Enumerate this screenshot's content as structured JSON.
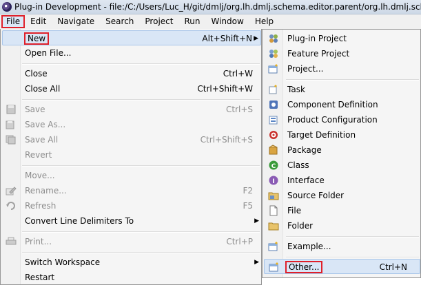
{
  "window": {
    "title": "Plug-in Development - file:/C:/Users/Luc_H/git/dmlj/org.lh.dmlj.schema.editor.parent/org.lh.dmlj.schema.editor"
  },
  "menubar": {
    "file": "File",
    "edit": "Edit",
    "navigate": "Navigate",
    "search": "Search",
    "project": "Project",
    "run": "Run",
    "window": "Window",
    "help": "Help"
  },
  "file_menu": {
    "new": {
      "label": "New",
      "accel": "Alt+Shift+N"
    },
    "open_file": {
      "label": "Open File..."
    },
    "close": {
      "label": "Close",
      "accel": "Ctrl+W"
    },
    "close_all": {
      "label": "Close All",
      "accel": "Ctrl+Shift+W"
    },
    "save": {
      "label": "Save",
      "accel": "Ctrl+S"
    },
    "save_as": {
      "label": "Save As..."
    },
    "save_all": {
      "label": "Save All",
      "accel": "Ctrl+Shift+S"
    },
    "revert": {
      "label": "Revert"
    },
    "move": {
      "label": "Move..."
    },
    "rename": {
      "label": "Rename...",
      "accel": "F2"
    },
    "refresh": {
      "label": "Refresh",
      "accel": "F5"
    },
    "convert": {
      "label": "Convert Line Delimiters To"
    },
    "print": {
      "label": "Print...",
      "accel": "Ctrl+P"
    },
    "switch_workspace": {
      "label": "Switch Workspace"
    },
    "restart": {
      "label": "Restart"
    }
  },
  "new_submenu": {
    "plugin_project": "Plug-in Project",
    "feature_project": "Feature Project",
    "project": "Project...",
    "task": "Task",
    "component_definition": "Component Definition",
    "product_configuration": "Product Configuration",
    "target_definition": "Target Definition",
    "package": "Package",
    "class": "Class",
    "interface": "Interface",
    "source_folder": "Source Folder",
    "file": "File",
    "folder": "Folder",
    "example": "Example...",
    "other": {
      "label": "Other...",
      "accel": "Ctrl+N"
    }
  }
}
